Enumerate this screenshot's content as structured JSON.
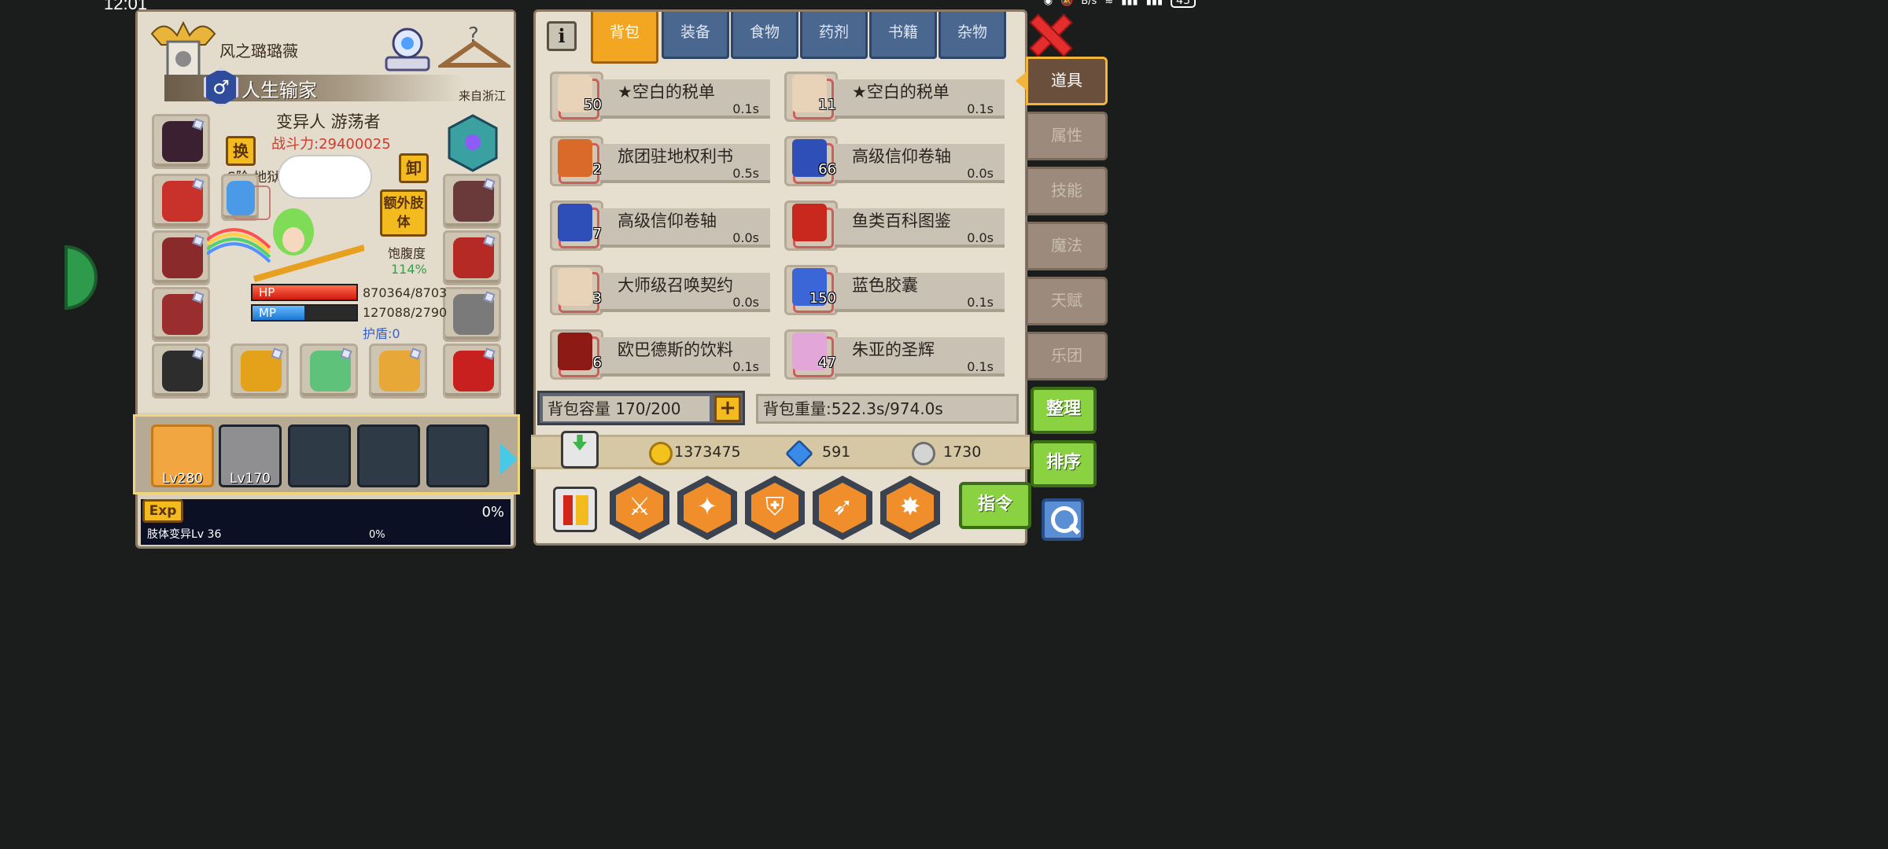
{
  "status_bar": {
    "time": "12:01",
    "net_speed": "B/s",
    "battery": "43"
  },
  "character": {
    "name": "风之璐璐薇",
    "title": "人生输家",
    "gender_symbol": "♂",
    "origin": "来自浙江",
    "class": "变异人 游荡者",
    "power": "战斗力:29400025",
    "rank": "S阶 地狱使徒 Lv 100",
    "swap_label": "换",
    "unequip_label": "卸",
    "extra_limb_label": "额外肢体",
    "satiety_label": "饱腹度",
    "satiety_value": "114%",
    "hp_label": "HP",
    "mp_label": "MP",
    "hp": "870364/8703",
    "mp": "127088/2790",
    "hp_fraction": 1.0,
    "mp_fraction": 0.5,
    "shield": "护盾:0"
  },
  "party": [
    {
      "level": "Lv280",
      "active": true
    },
    {
      "level": "Lv170",
      "active": false
    },
    {
      "level": "",
      "active": false
    },
    {
      "level": "",
      "active": false
    },
    {
      "level": "",
      "active": false
    }
  ],
  "exp": {
    "label": "Exp",
    "percent": "0%",
    "mutation_label": "肢体变异Lv 36",
    "mutation_percent": "0%"
  },
  "tabs": [
    {
      "label": "背包",
      "active": true
    },
    {
      "label": "装备",
      "active": false
    },
    {
      "label": "食物",
      "active": false
    },
    {
      "label": "药剂",
      "active": false
    },
    {
      "label": "书籍",
      "active": false
    },
    {
      "label": "杂物",
      "active": false
    }
  ],
  "items": [
    {
      "name": "★空白的税单",
      "count": "50",
      "weight": "0.1s",
      "icon_color": "#e8d2b8"
    },
    {
      "name": "★空白的税单",
      "count": "11",
      "weight": "0.1s",
      "icon_color": "#e8d2b8"
    },
    {
      "name": "旅团驻地权利书",
      "count": "2",
      "weight": "0.5s",
      "icon_color": "#d96a2a"
    },
    {
      "name": "高级信仰卷轴",
      "count": "66",
      "weight": "0.0s",
      "icon_color": "#2f4fb8"
    },
    {
      "name": "高级信仰卷轴",
      "count": "7",
      "weight": "0.0s",
      "icon_color": "#2f4fb8"
    },
    {
      "name": "鱼类百科图鉴",
      "count": "",
      "weight": "0.0s",
      "icon_color": "#c8281e"
    },
    {
      "name": "大师级召唤契约",
      "count": "3",
      "weight": "0.0s",
      "icon_color": "#e8d2b8"
    },
    {
      "name": "蓝色胶囊",
      "count": "150",
      "weight": "0.1s",
      "icon_color": "#3a66d8"
    },
    {
      "name": "欧巴德斯的饮料",
      "count": "6",
      "weight": "0.1s",
      "icon_color": "#8e1a16"
    },
    {
      "name": "朱亚的圣辉",
      "count": "47",
      "weight": "0.1s",
      "icon_color": "#e2a6d8"
    }
  ],
  "bag": {
    "capacity": "背包容量 170/200",
    "weight": "背包重量:522.3s/974.0s",
    "add_label": "+"
  },
  "currency": {
    "gold": "1373475",
    "diamond": "591",
    "silver": "1730"
  },
  "skills": [
    {
      "glyph": "⚔"
    },
    {
      "glyph": "✦"
    },
    {
      "glyph": "⛨"
    },
    {
      "glyph": "➶"
    },
    {
      "glyph": "✸"
    }
  ],
  "command_label": "指令",
  "info_label": "i",
  "side_tabs": [
    {
      "label": "道具",
      "active": true
    },
    {
      "label": "属性",
      "active": false
    },
    {
      "label": "技能",
      "active": false
    },
    {
      "label": "魔法",
      "active": false
    },
    {
      "label": "天赋",
      "active": false
    },
    {
      "label": "乐团",
      "active": false
    }
  ],
  "buttons": {
    "sort": "整理",
    "order": "排序"
  },
  "colors": {
    "accent_tab": "#f3a621",
    "tab_blue": "#4a6790",
    "hp_red": "#d21a10",
    "mp_blue": "#1a78d2",
    "green_btn": "#8bd243"
  }
}
